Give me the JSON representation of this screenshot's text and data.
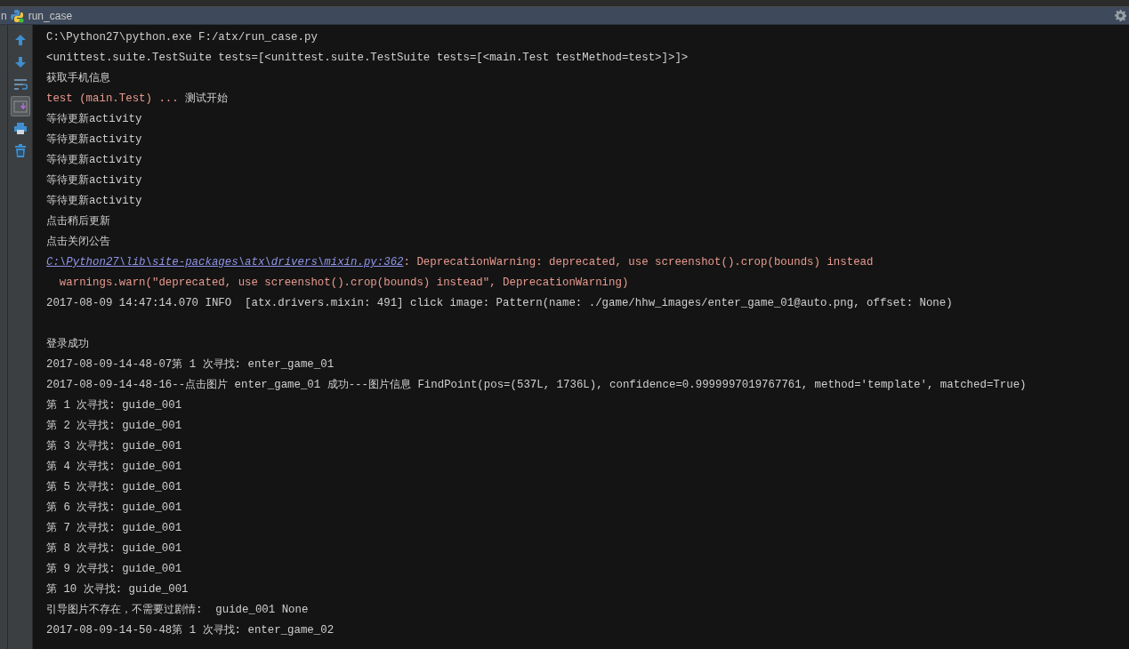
{
  "tool_window": {
    "cut_label": "n",
    "title": "run_case"
  },
  "toolbar": [
    {
      "kind": "up",
      "selected": false
    },
    {
      "kind": "down",
      "selected": false
    },
    {
      "kind": "wrap",
      "selected": false
    },
    {
      "kind": "scroll",
      "selected": true
    },
    {
      "kind": "print",
      "selected": false
    },
    {
      "kind": "trash",
      "selected": false
    }
  ],
  "console_lines": [
    {
      "segments": [
        {
          "kind": "normal",
          "text": "C:\\Python27\\python.exe F:/atx/run_case.py"
        }
      ]
    },
    {
      "segments": [
        {
          "kind": "normal",
          "text": "<unittest.suite.TestSuite tests=[<unittest.suite.TestSuite tests=[<main.Test testMethod=test>]>]>"
        }
      ]
    },
    {
      "segments": [
        {
          "kind": "normal",
          "text": "获取手机信息"
        }
      ]
    },
    {
      "segments": [
        {
          "kind": "error",
          "text": "test (main.Test) ... "
        },
        {
          "kind": "normal",
          "text": "测试开始"
        }
      ]
    },
    {
      "segments": [
        {
          "kind": "normal",
          "text": "等待更新activity"
        }
      ]
    },
    {
      "segments": [
        {
          "kind": "normal",
          "text": "等待更新activity"
        }
      ]
    },
    {
      "segments": [
        {
          "kind": "normal",
          "text": "等待更新activity"
        }
      ]
    },
    {
      "segments": [
        {
          "kind": "normal",
          "text": "等待更新activity"
        }
      ]
    },
    {
      "segments": [
        {
          "kind": "normal",
          "text": "等待更新activity"
        }
      ]
    },
    {
      "segments": [
        {
          "kind": "normal",
          "text": "点击稍后更新"
        }
      ]
    },
    {
      "segments": [
        {
          "kind": "normal",
          "text": "点击关闭公告"
        }
      ]
    },
    {
      "segments": [
        {
          "kind": "link",
          "text": "C:\\Python27\\lib\\site-packages\\atx\\drivers\\mixin.py:362"
        },
        {
          "kind": "error",
          "text": ": DeprecationWarning: deprecated, use screenshot().crop(bounds) instead"
        }
      ]
    },
    {
      "segments": [
        {
          "kind": "error",
          "text": "  warnings.warn(\"deprecated, use screenshot().crop(bounds) instead\", DeprecationWarning)"
        }
      ]
    },
    {
      "blank_after": true,
      "segments": [
        {
          "kind": "normal",
          "text": "2017-08-09 14:47:14.070 INFO  [atx.drivers.mixin: 491] click image: Pattern(name: ./game/hhw_images/enter_game_01@auto.png, offset: None)"
        }
      ]
    },
    {
      "segments": [
        {
          "kind": "normal",
          "text": "登录成功"
        }
      ]
    },
    {
      "segments": [
        {
          "kind": "normal",
          "text": "2017-08-09-14-48-07第 1 次寻找: enter_game_01"
        }
      ]
    },
    {
      "segments": [
        {
          "kind": "normal",
          "text": "2017-08-09-14-48-16--点击图片 enter_game_01 成功---图片信息 FindPoint(pos=(537L, 1736L), confidence=0.9999997019767761, method='template', matched=True)"
        }
      ]
    },
    {
      "segments": [
        {
          "kind": "normal",
          "text": "第 1 次寻找: guide_001"
        }
      ]
    },
    {
      "segments": [
        {
          "kind": "normal",
          "text": "第 2 次寻找: guide_001"
        }
      ]
    },
    {
      "segments": [
        {
          "kind": "normal",
          "text": "第 3 次寻找: guide_001"
        }
      ]
    },
    {
      "segments": [
        {
          "kind": "normal",
          "text": "第 4 次寻找: guide_001"
        }
      ]
    },
    {
      "segments": [
        {
          "kind": "normal",
          "text": "第 5 次寻找: guide_001"
        }
      ]
    },
    {
      "segments": [
        {
          "kind": "normal",
          "text": "第 6 次寻找: guide_001"
        }
      ]
    },
    {
      "segments": [
        {
          "kind": "normal",
          "text": "第 7 次寻找: guide_001"
        }
      ]
    },
    {
      "segments": [
        {
          "kind": "normal",
          "text": "第 8 次寻找: guide_001"
        }
      ]
    },
    {
      "segments": [
        {
          "kind": "normal",
          "text": "第 9 次寻找: guide_001"
        }
      ]
    },
    {
      "segments": [
        {
          "kind": "normal",
          "text": "第 10 次寻找: guide_001"
        }
      ]
    },
    {
      "segments": [
        {
          "kind": "normal",
          "text": "引导图片不存在，不需要过剧情:  guide_001 None"
        }
      ]
    },
    {
      "segments": [
        {
          "kind": "normal",
          "text": "2017-08-09-14-50-48第 1 次寻找: enter_game_02"
        }
      ]
    }
  ]
}
